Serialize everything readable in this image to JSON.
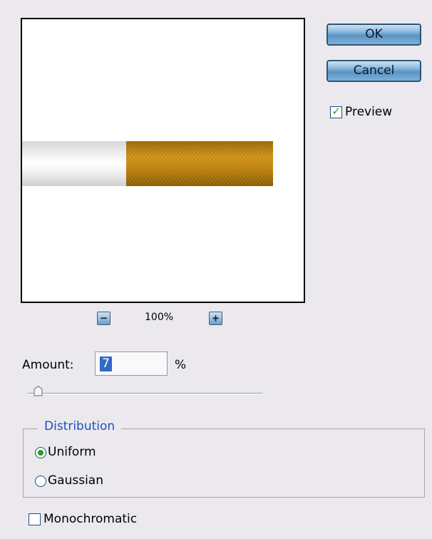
{
  "buttons": {
    "ok_label": "OK",
    "cancel_label": "Cancel"
  },
  "preview_toggle": {
    "label": "Preview",
    "checked": true
  },
  "zoom": {
    "level_label": "100%",
    "zoom_out_icon": "minus-icon",
    "zoom_in_icon": "plus-icon"
  },
  "amount": {
    "label": "Amount:",
    "value": "7",
    "unit": "%"
  },
  "slider": {
    "value": 7,
    "min": 0,
    "max": 400
  },
  "distribution": {
    "title": "Distribution",
    "options": [
      {
        "label": "Uniform",
        "selected": true
      },
      {
        "label": "Gaussian",
        "selected": false
      }
    ]
  },
  "monochromatic": {
    "label": "Monochromatic",
    "checked": false
  },
  "colors": {
    "accent": "#316ac5",
    "check_green": "#21a121",
    "group_title_blue": "#1d4fc6"
  }
}
